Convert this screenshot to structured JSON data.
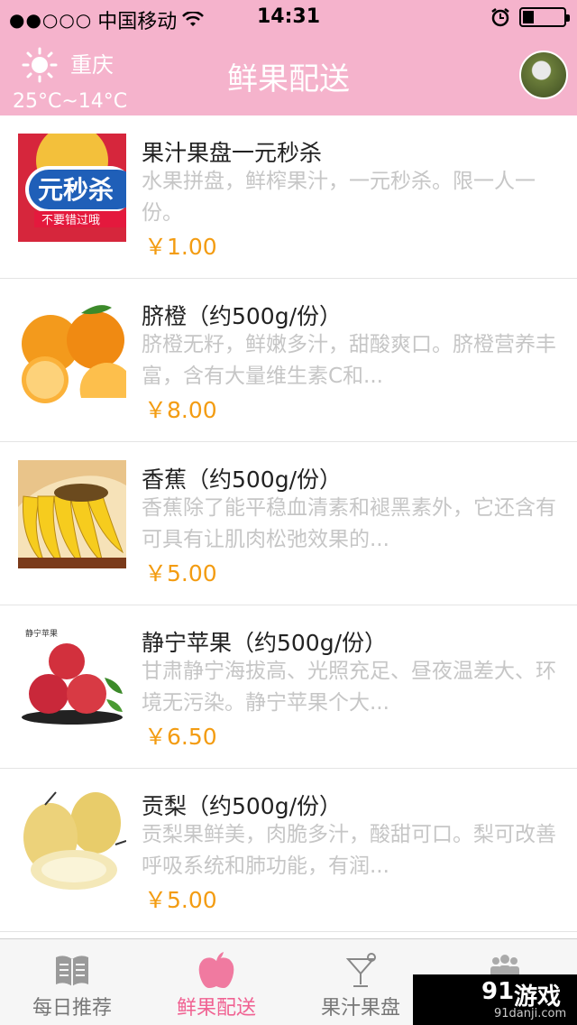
{
  "status": {
    "signal": "●●○○○",
    "carrier": "中国移动",
    "time": "14:31"
  },
  "header": {
    "city": "重庆",
    "temperature": "25°C~14°C",
    "title": "鲜果配送"
  },
  "items": [
    {
      "title": "果汁果盘一元秒杀",
      "desc": "水果拼盘，鲜榨果汁，一元秒杀。限一人一份。",
      "price": "￥1.00",
      "banner_main": "元秒杀",
      "banner_sub": "不要错过哦"
    },
    {
      "title": "脐橙（约500g/份）",
      "desc": "脐橙无籽，鲜嫩多汁，甜酸爽口。脐橙营养丰富，含有大量维生素C和...",
      "price": "￥8.00"
    },
    {
      "title": "香蕉（约500g/份）",
      "desc": "香蕉除了能平稳血清素和褪黑素外，它还含有可具有让肌肉松弛效果的...",
      "price": "￥5.00"
    },
    {
      "title": "静宁苹果（约500g/份）",
      "desc": "甘肃静宁海拔高、光照充足、昼夜温差大、环境无污染。静宁苹果个大...",
      "price": "￥6.50",
      "image_caption": "静宁苹果"
    },
    {
      "title": "贡梨（约500g/份）",
      "desc": "贡梨果鲜美，肉脆多汁，酸甜可口。梨可改善呼吸系统和肺功能，有润...",
      "price": "￥5.00"
    }
  ],
  "tabs": [
    {
      "label": "每日推荐",
      "icon": "book-icon"
    },
    {
      "label": "鲜果配送",
      "icon": "apple-icon"
    },
    {
      "label": "果汁果盘",
      "icon": "cocktail-icon"
    },
    {
      "label": "",
      "icon": "people-icon"
    }
  ],
  "watermark": {
    "brand_num": "91",
    "brand": "游戏",
    "url": "91danji.com"
  },
  "colors": {
    "header_bg": "#f5b3cc",
    "price": "#f39c12",
    "active_tab": "#f06292"
  }
}
